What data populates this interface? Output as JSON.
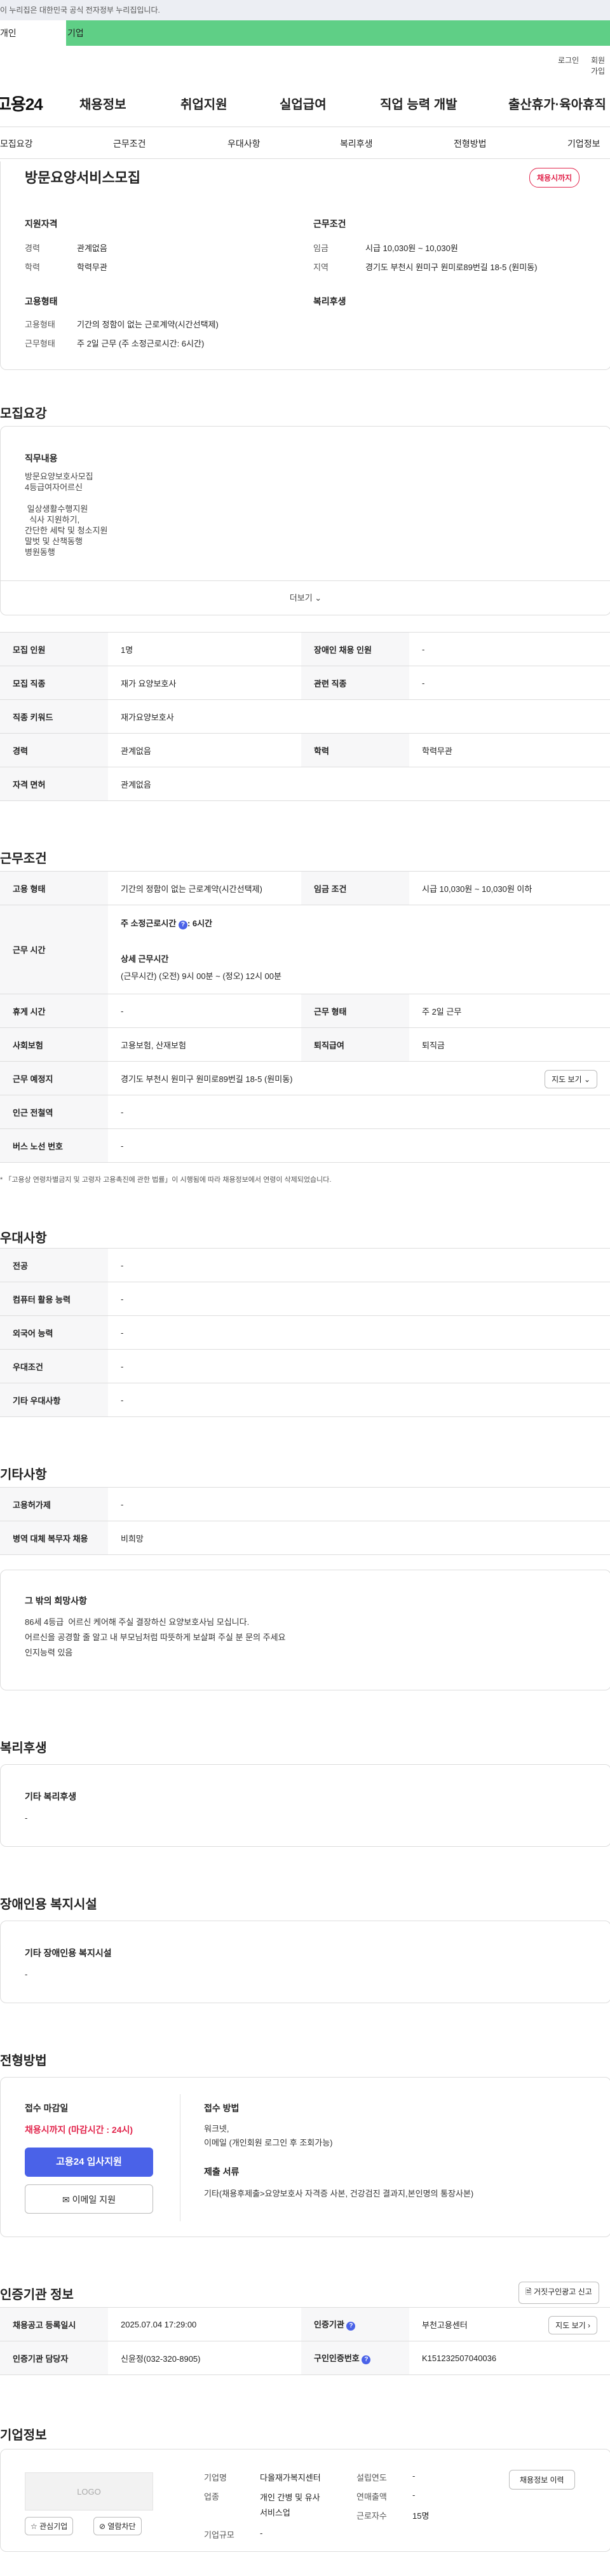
{
  "gov_banner": "이 누리집은 대한민국 공식 전자정부 누리집입니다.",
  "tabs": {
    "person": "개인",
    "company": "기업"
  },
  "util": {
    "login": "로그인",
    "join": "회원가입"
  },
  "gnb": {
    "logo": "고용24",
    "menu": [
      "채용정보",
      "취업지원",
      "실업급여",
      "직업 능력 개발",
      "출산휴가·육아휴직"
    ]
  },
  "anchor": [
    "모집요강",
    "근무조건",
    "우대사항",
    "복리후생",
    "전형방법",
    "기업정보"
  ],
  "job": {
    "title": "방문요양서비스모집",
    "badge": "채용시까지",
    "qual_title": "지원자격",
    "career_label": "경력",
    "career": "관계없음",
    "edu_label": "학력",
    "edu": "학력무관",
    "cond_title": "근무조건",
    "wage_label": "임금",
    "wage": "시급 10,030원 ~ 10,030원",
    "region_label": "지역",
    "region": "경기도 부천시 원미구 원미로89번길 18-5 (원미동)",
    "emp_title": "고용형태",
    "emp_type_label": "고용형태",
    "emp_type": "기간의 정함이 없는 근로계약(시간선택제)",
    "work_label": "근무형태",
    "work": "주 2일 근무 (주 소정근로시간: 6시간)",
    "welfare_title": "복리후생"
  },
  "recruit": {
    "section": "모집요강",
    "duties_title": "직무내용",
    "duties": [
      "방문요양보호사모집",
      "4등급여자어르신",
      "",
      " 일상생활수행지원",
      "  식사 지원하기,",
      "간단한 세탁 및 청소지원",
      "말벗 및 산책동행",
      "병원동행"
    ],
    "more": "더보기",
    "table": [
      [
        "모집 인원",
        "1명",
        "장애인 채용 인원",
        "-"
      ],
      [
        "모집 직종",
        "재가 요양보호사",
        "관련 직종",
        "-"
      ],
      [
        "직종 키워드",
        "재가요양보호사",
        "",
        ""
      ],
      [
        "경력",
        "관계없음",
        "학력",
        "학력무관"
      ],
      [
        "자격 면허",
        "관계없음",
        "",
        ""
      ]
    ]
  },
  "work": {
    "section": "근무조건",
    "emp_type_label": "고용 형태",
    "emp_type": "기간의 정함이 없는 근로계약(시간선택제)",
    "wage_label": "임금 조건",
    "wage": "시급 10,030원 ~ 10,030원 이하",
    "hours_label": "근무 시간",
    "hours_weekly_label": "주 소정근로시간",
    "hours_weekly": ": 6시간",
    "hours_detail_label": "상세 근무시간",
    "hours_detail": "(근무시간) (오전) 9시 00분 ~ (정오) 12시 00분",
    "rest_label": "휴게 시간",
    "rest": "-",
    "form_label": "근무 형태",
    "form": "주 2일 근무",
    "insurance_label": "사회보험",
    "insurance": "고용보험, 산재보험",
    "retire_label": "퇴직급여",
    "retire": "퇴직금",
    "place_label": "근무 예정지",
    "place": "경기도 부천시 원미구 원미로89번길 18-5 (원미동)",
    "map_btn": "지도 보기",
    "subway_label": "인근 전철역",
    "subway": "-",
    "bus_label": "버스 노선 번호",
    "bus": "-",
    "note": "* 「고용상 연령차별금지 및 고령자 고용촉진에 관한 법률」이 시행됨에 따라 채용정보에서 연령이 삭제되었습니다."
  },
  "pref": {
    "section": "우대사항",
    "rows": [
      [
        "전공",
        "-"
      ],
      [
        "컴퓨터 활용 능력",
        "-"
      ],
      [
        "외국어 능력",
        "-"
      ],
      [
        "우대조건",
        "-"
      ],
      [
        "기타 우대사항",
        "-"
      ]
    ]
  },
  "etc": {
    "section": "기타사항",
    "rows": [
      [
        "고용허가제",
        "-"
      ],
      [
        "병역 대체 복무자 채용",
        "비희망"
      ]
    ],
    "desc_title": "그 밖의 희망사항",
    "desc": [
      "86세 4등급  어르신 케어해 주실 결장하신 요양보호사님 모십니다.",
      "어르신을 공경할 줄 알고 내 부모님처럼 따뜻하게 보살펴 주실 분 문의 주세요",
      "인지능력 있음"
    ]
  },
  "welfare": {
    "section": "복리후생",
    "title": "기타 복리후생",
    "value": "-"
  },
  "disabled": {
    "section": "장애인용 복지시설",
    "title": "기타 장애인용 복지시설",
    "value": "-"
  },
  "selection": {
    "section": "전형방법",
    "deadline_title": "접수 마감일",
    "deadline": "채용시까지 (마감시간 : 24시)",
    "apply_btn": "고용24 입사지원",
    "email_btn": "이메일 지원",
    "method_title": "접수 방법",
    "method": [
      "워크넷,",
      "이메일 (개인회원 로그인 후 조회가능)"
    ],
    "docs_title": "제출 서류",
    "docs": "기타(채용후제출>요양보호사 자격증 사본, 건강검진 결과지,본인명의 통장사본)"
  },
  "cert": {
    "section": "인증기관 정보",
    "report_btn": "거짓구인광고 신고",
    "reg_label": "채용공고 등록일시",
    "reg": "2025.07.04 17:29:00",
    "agency_label": "인증기관",
    "agency": "부천고용센터",
    "map_btn": "지도 보기",
    "manager_label": "인증기관 담당자",
    "manager": "신윤정(032-320-8905)",
    "cert_no_label": "구인인증번호",
    "cert_no": "K151232507040036"
  },
  "company": {
    "section": "기업정보",
    "logo": "LOGO",
    "interest_btn": "관심기업",
    "block_btn": "열람차단",
    "name_label": "기업명",
    "name": "다올재가복지센터",
    "industry_label": "업종",
    "industry": [
      "개인 간병 및 유사",
      "서비스업"
    ],
    "size_label": "기업규모",
    "size": "-",
    "founded_label": "설립연도",
    "founded": "-",
    "revenue_label": "연매출액",
    "revenue": "-",
    "employees_label": "근로자수",
    "employees": "15명",
    "history_btn": "채용정보 이력"
  },
  "colors": {
    "primary": "#4a62e8",
    "accent_red": "#e2264d",
    "company_tab": "#5fcf86"
  }
}
